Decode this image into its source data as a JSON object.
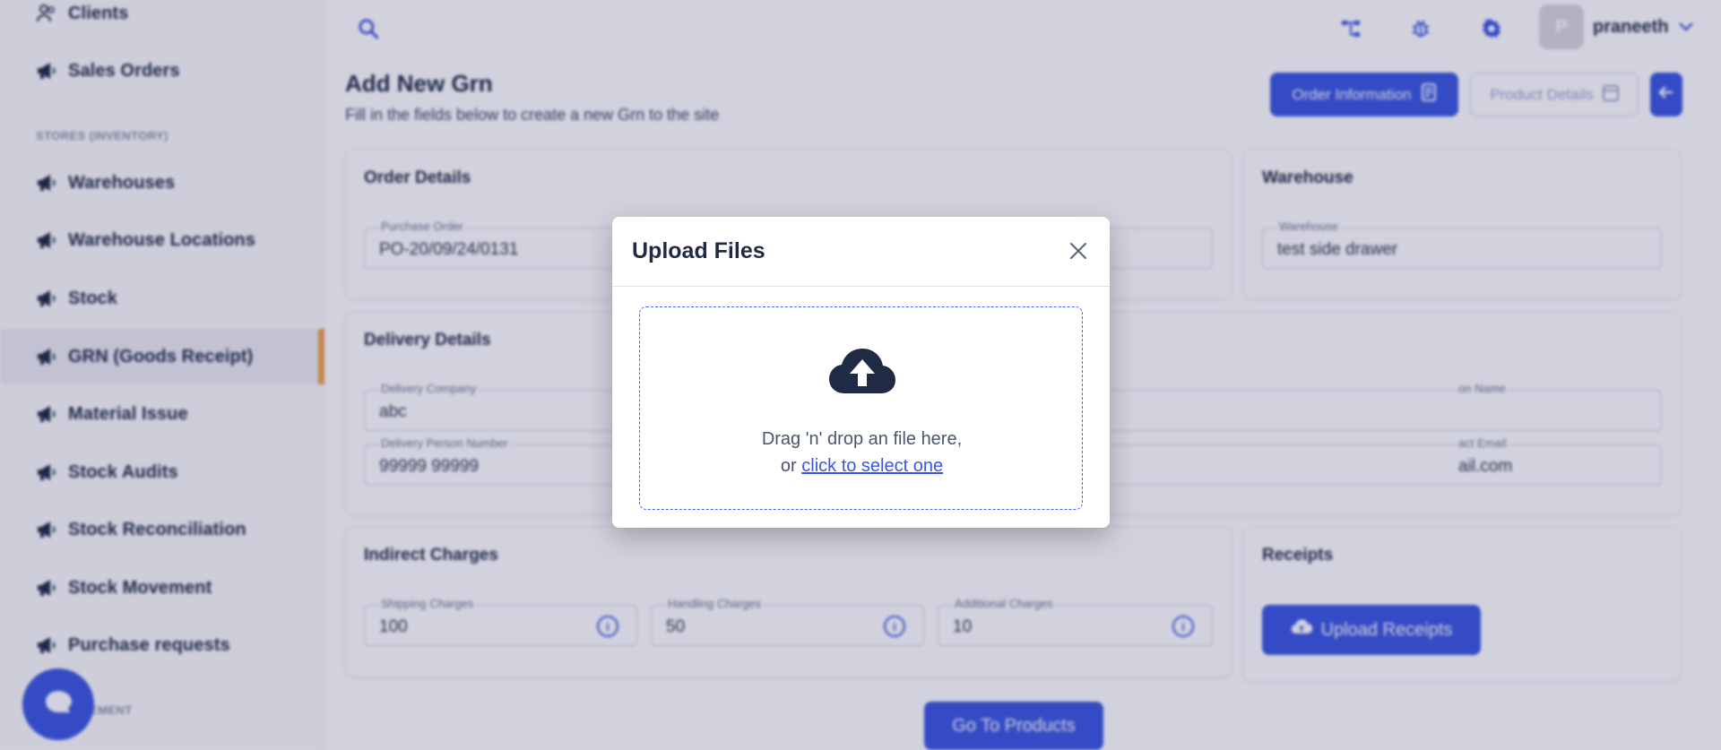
{
  "sidebar": {
    "items": [
      {
        "label": "Clients"
      },
      {
        "label": "Sales Orders"
      },
      {
        "label": "Warehouses"
      },
      {
        "label": "Warehouse Locations"
      },
      {
        "label": "Stock"
      },
      {
        "label": "GRN (Goods Receipt)"
      },
      {
        "label": "Material Issue"
      },
      {
        "label": "Stock Audits"
      },
      {
        "label": "Stock Reconciliation"
      },
      {
        "label": "Stock Movement"
      },
      {
        "label": "Purchase requests"
      }
    ],
    "sections": {
      "stores": "STORES (INVENTORY)",
      "next_partial": "EMENT"
    },
    "active_item": "GRN (Goods Receipt)"
  },
  "header": {
    "username": "praneeth",
    "avatar_initial": "P"
  },
  "page": {
    "title": "Add New Grn",
    "subtitle": "Fill in the fields below to create a new Grn to the site",
    "order_info_button": "Order Information",
    "product_details_button": "Product Details",
    "go_to_products_button": "Go To Products"
  },
  "order_details": {
    "title": "Order Details",
    "purchase_order_label": "Purchase Order",
    "purchase_order_value": "PO-20/09/24/0131"
  },
  "warehouse": {
    "title": "Warehouse",
    "label": "Warehouse",
    "value": "test side drawer"
  },
  "delivery_details": {
    "title": "Delivery Details",
    "company_label": "Delivery Company",
    "company_value": "abc",
    "person_number_label": "Delivery Person Number",
    "person_number_value": "99999 99999",
    "person_name_label_partial": "on Name",
    "contact_email_label_partial": "act Email",
    "contact_email_value_partial": "ail.com"
  },
  "indirect_charges": {
    "title": "Indirect Charges",
    "shipping_label": "Shipping Charges",
    "shipping_value": "100",
    "handling_label": "Handling Charges",
    "handling_value": "50",
    "additional_label": "Additional Charges",
    "additional_value": "10"
  },
  "receipts": {
    "title": "Receipts",
    "upload_button": "Upload Receipts"
  },
  "modal": {
    "title": "Upload Files",
    "dropzone_line1": "Drag 'n' drop an file here,",
    "dropzone_or": "or",
    "dropzone_link": "click to select one"
  },
  "colors": {
    "primary": "#3a57e0",
    "active_indicator": "#f0a047",
    "text_dark": "#1f2a44",
    "cloud_icon": "#1f2a44"
  },
  "icons": {
    "sidebar": "megaphone-icon",
    "top": [
      "search-icon",
      "sitemap-icon",
      "bug-icon",
      "gear-icon",
      "chevron-down-icon"
    ],
    "modal_close": "close-icon",
    "dropzone": "cloud-upload-icon"
  }
}
